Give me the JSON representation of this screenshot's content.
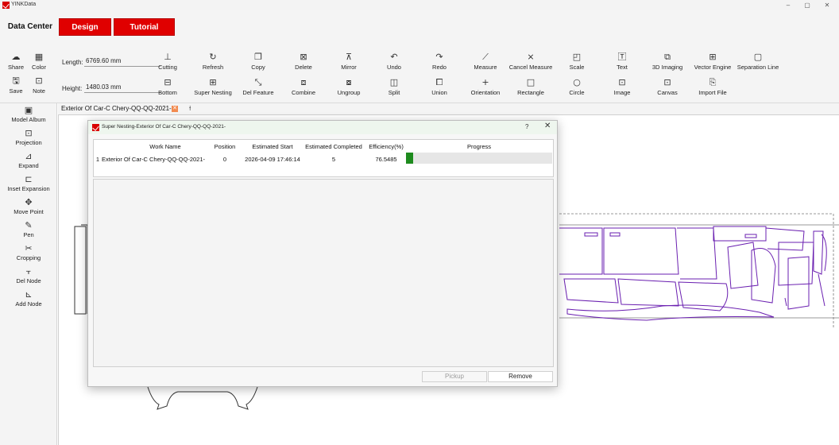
{
  "window": {
    "title": "YINKData",
    "controls": [
      "–",
      "▢",
      "✕"
    ]
  },
  "nav": {
    "tabs": [
      {
        "label": "Data Center"
      },
      {
        "label": "Design Center"
      },
      {
        "label": "Tutorial"
      }
    ]
  },
  "toolbar": {
    "left_tools": [
      {
        "label": "Share",
        "icon": "cloud-share-icon"
      },
      {
        "label": "Color",
        "icon": "palette-icon"
      },
      {
        "label": "Save",
        "icon": "save-icon"
      },
      {
        "label": "Note",
        "icon": "note-icon"
      }
    ],
    "length_label": "Length:",
    "length_value": "6769.60 mm",
    "height_label": "Height:",
    "height_value": "1480.03 mm",
    "row1": [
      {
        "label": "Cutting",
        "icon": "cutting-icon"
      },
      {
        "label": "Refresh",
        "icon": "refresh-icon"
      },
      {
        "label": "Copy",
        "icon": "copy-icon"
      },
      {
        "label": "Delete",
        "icon": "delete-icon"
      },
      {
        "label": "Mirror",
        "icon": "mirror-icon"
      },
      {
        "label": "Undo",
        "icon": "undo-icon"
      },
      {
        "label": "Redo",
        "icon": "redo-icon"
      },
      {
        "label": "Measure",
        "icon": "measure-icon"
      },
      {
        "label": "Cancel Measure",
        "icon": "cancel-measure-icon"
      },
      {
        "label": "Scale",
        "icon": "scale-icon"
      },
      {
        "label": "Text",
        "icon": "text-icon"
      },
      {
        "label": "3D Imaging",
        "icon": "3d-imaging-icon"
      },
      {
        "label": "Vector Engine",
        "icon": "vector-engine-icon"
      },
      {
        "label": "Separation Line",
        "icon": "separation-line-icon"
      }
    ],
    "row2": [
      {
        "label": "Bottom",
        "icon": "bottom-icon"
      },
      {
        "label": "Super Nesting",
        "icon": "super-nesting-icon"
      },
      {
        "label": "Del Feature",
        "icon": "del-feature-icon"
      },
      {
        "label": "Combine",
        "icon": "combine-icon"
      },
      {
        "label": "Ungroup",
        "icon": "ungroup-icon"
      },
      {
        "label": "Split",
        "icon": "split-icon"
      },
      {
        "label": "Union",
        "icon": "union-icon"
      },
      {
        "label": "Orientation",
        "icon": "orientation-icon"
      },
      {
        "label": "Rectangle",
        "icon": "rectangle-icon"
      },
      {
        "label": "Circle",
        "icon": "circle-icon"
      },
      {
        "label": "Image",
        "icon": "image-icon"
      },
      {
        "label": "Canvas",
        "icon": "canvas-icon"
      },
      {
        "label": "Import File",
        "icon": "import-file-icon"
      }
    ]
  },
  "sidebar": {
    "items": [
      {
        "label": "Model Album",
        "icon": "model-album-icon"
      },
      {
        "label": "Projection",
        "icon": "projection-icon"
      },
      {
        "label": "Expand",
        "icon": "expand-icon"
      },
      {
        "label": "Inset Expansion",
        "icon": "inset-expansion-icon"
      },
      {
        "label": "Move Point",
        "icon": "move-point-icon"
      },
      {
        "label": "Pen",
        "icon": "pen-icon"
      },
      {
        "label": "Cropping",
        "icon": "scissors-icon"
      },
      {
        "label": "Del Node",
        "icon": "del-node-icon"
      },
      {
        "label": "Add Node",
        "icon": "add-node-icon"
      }
    ]
  },
  "document": {
    "tab_label": "Exterior Of Car-C Chery-QQ-QQ-2021-",
    "close_glyph": "✕",
    "pin_glyph": "⟊"
  },
  "dialog": {
    "title": "Super Nesting-Exterior Of Car-C Chery-QQ-QQ-2021-",
    "help_glyph": "?",
    "close_glyph": "✕",
    "columns": [
      "Work Name",
      "Position",
      "Estimated Start",
      "Estimated Completed",
      "Efficiency(%)",
      "Progress"
    ],
    "rows": [
      {
        "index": "1",
        "work_name": "Exterior Of Car-C Chery-QQ-QQ-2021-",
        "position": "0",
        "estimated_start": "2026-04-09 17:46:14",
        "estimated_completed": "5",
        "efficiency": "76.5485",
        "progress_fraction": 0.05
      }
    ],
    "buttons": {
      "pickup": "Pickup",
      "remove": "Remove"
    },
    "progress_color": "#1e8b1e"
  },
  "colors": {
    "brand_red": "#e00000",
    "nesting_outline": "#6a1fb0"
  }
}
